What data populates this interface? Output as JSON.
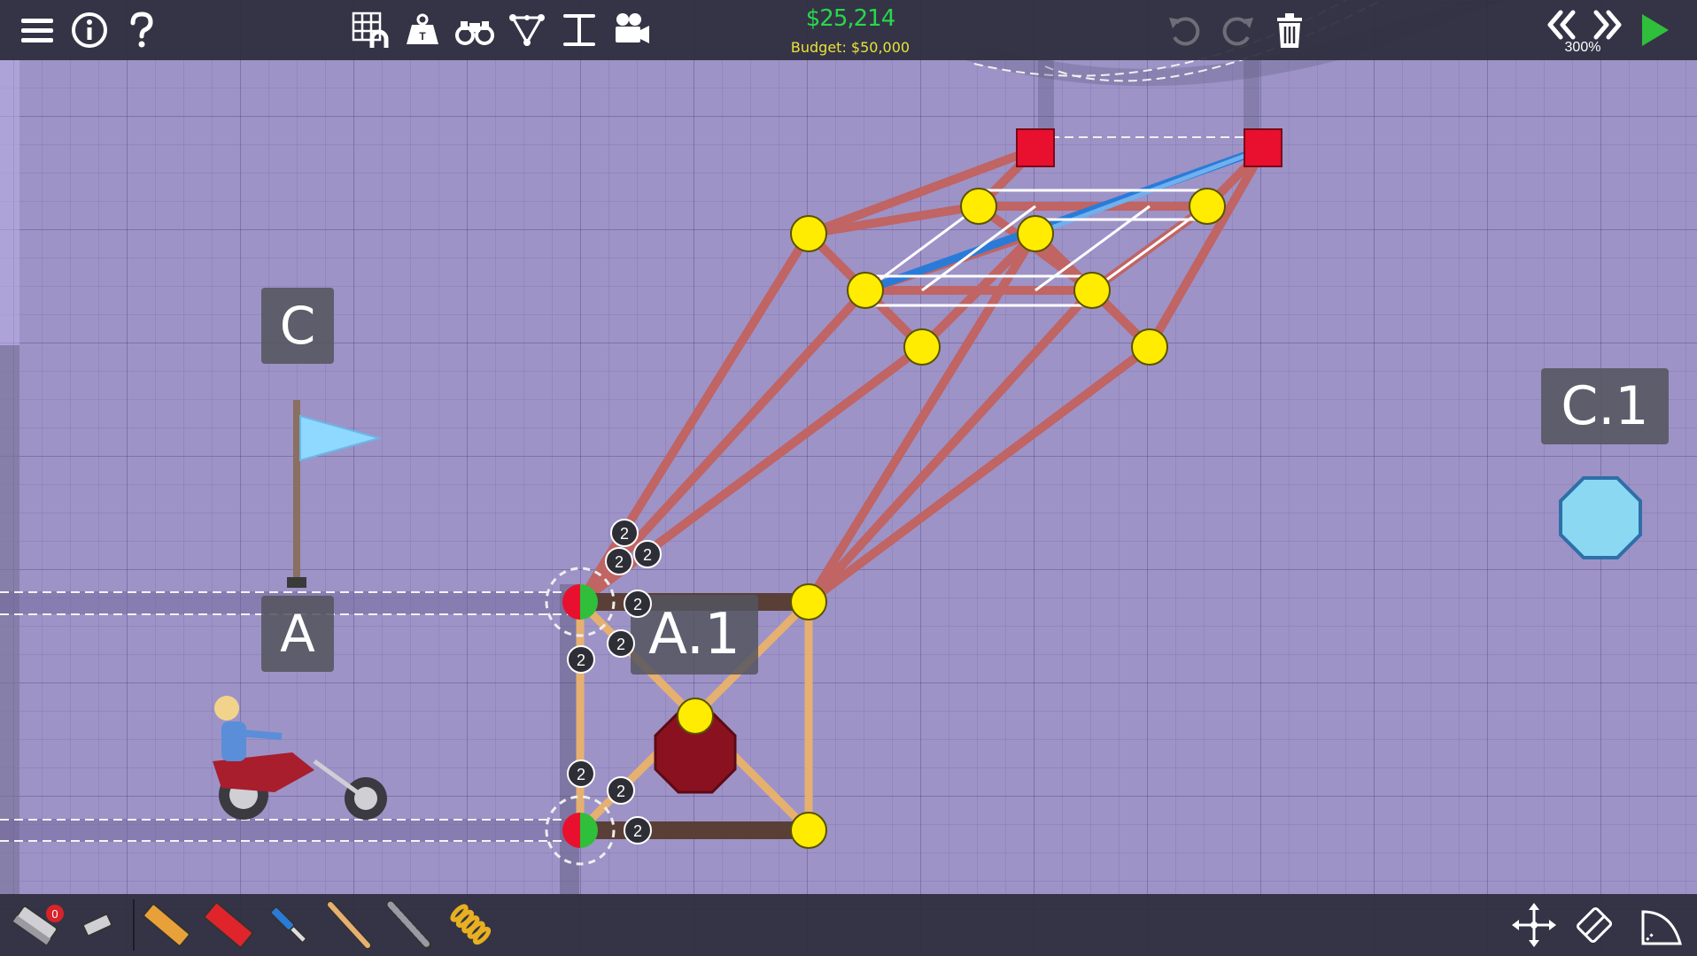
{
  "colors": {
    "background": "#9d93c7",
    "bar": "#2d2d3c",
    "money": "#25d94a",
    "budget": "#e8e23a",
    "play": "#2fbf3a",
    "anchor": "#e8102e",
    "joint": "#ffec00",
    "steel": "#c06464",
    "wood": "#e6b070",
    "cable": "#2a7bd8",
    "road": "#5a3f37"
  },
  "toolbar": {
    "left": [
      "menu-icon",
      "info-icon",
      "help-icon"
    ],
    "center": [
      "grid-magnet-icon",
      "weight-icon",
      "binoculars-icon",
      "triangle-nodes-icon",
      "measure-icon",
      "camera-icon"
    ],
    "right": [
      "undo-icon",
      "redo-icon",
      "trash-icon"
    ]
  },
  "cost": "$25,214",
  "budget": "Budget: $50,000",
  "playback": {
    "rewind": "rewind-icon",
    "fast_forward": "fast-forward-icon",
    "speed": "300%",
    "play": "play-icon"
  },
  "labels": {
    "c": "C",
    "a": "A",
    "a1": "A.1",
    "c1": "C.1"
  },
  "joint_count_label": "2",
  "materials": {
    "item_count": "0",
    "items": [
      "road-brick-icon",
      "eraser-icon",
      "wood-plank-icon",
      "reinforced-road-icon",
      "hydraulic-icon",
      "wood-beam-icon",
      "steel-beam-icon",
      "spring-icon"
    ]
  },
  "bottom_right": [
    "move-icon",
    "eraser-icon",
    "shape-icon"
  ]
}
